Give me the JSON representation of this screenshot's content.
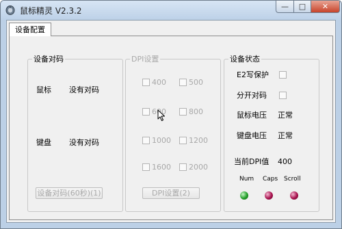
{
  "window": {
    "title": "鼠标精灵 V2.3.2",
    "controls": {
      "minimize": "—",
      "maximize": "□",
      "close": "✕"
    }
  },
  "tabs": [
    {
      "label": "设备配置"
    }
  ],
  "pairing": {
    "legend": "设备对码",
    "mouse_label": "鼠标",
    "mouse_status": "没有对码",
    "keyboard_label": "键盘",
    "keyboard_status": "没有对码",
    "button": "设备对码(60秒)(1)"
  },
  "dpi": {
    "legend": "DPI设置",
    "options": [
      "400",
      "500",
      "600",
      "800",
      "1000",
      "1200",
      "1600",
      "2000"
    ],
    "button": "DPI设置(2)"
  },
  "status": {
    "legend": "设备状态",
    "e2_protect_label": "E2写保护",
    "separate_pair_label": "分开对码",
    "mouse_voltage_label": "鼠标电压",
    "mouse_voltage_value": "正常",
    "keyboard_voltage_label": "键盘电压",
    "keyboard_voltage_value": "正常",
    "current_dpi_label": "当前DPI值",
    "current_dpi_value": "400",
    "indicators": [
      {
        "label": "Num",
        "color": "#24a02a"
      },
      {
        "label": "Caps",
        "color": "#a8124e"
      },
      {
        "label": "Scroll",
        "color": "#a8124e"
      }
    ]
  }
}
